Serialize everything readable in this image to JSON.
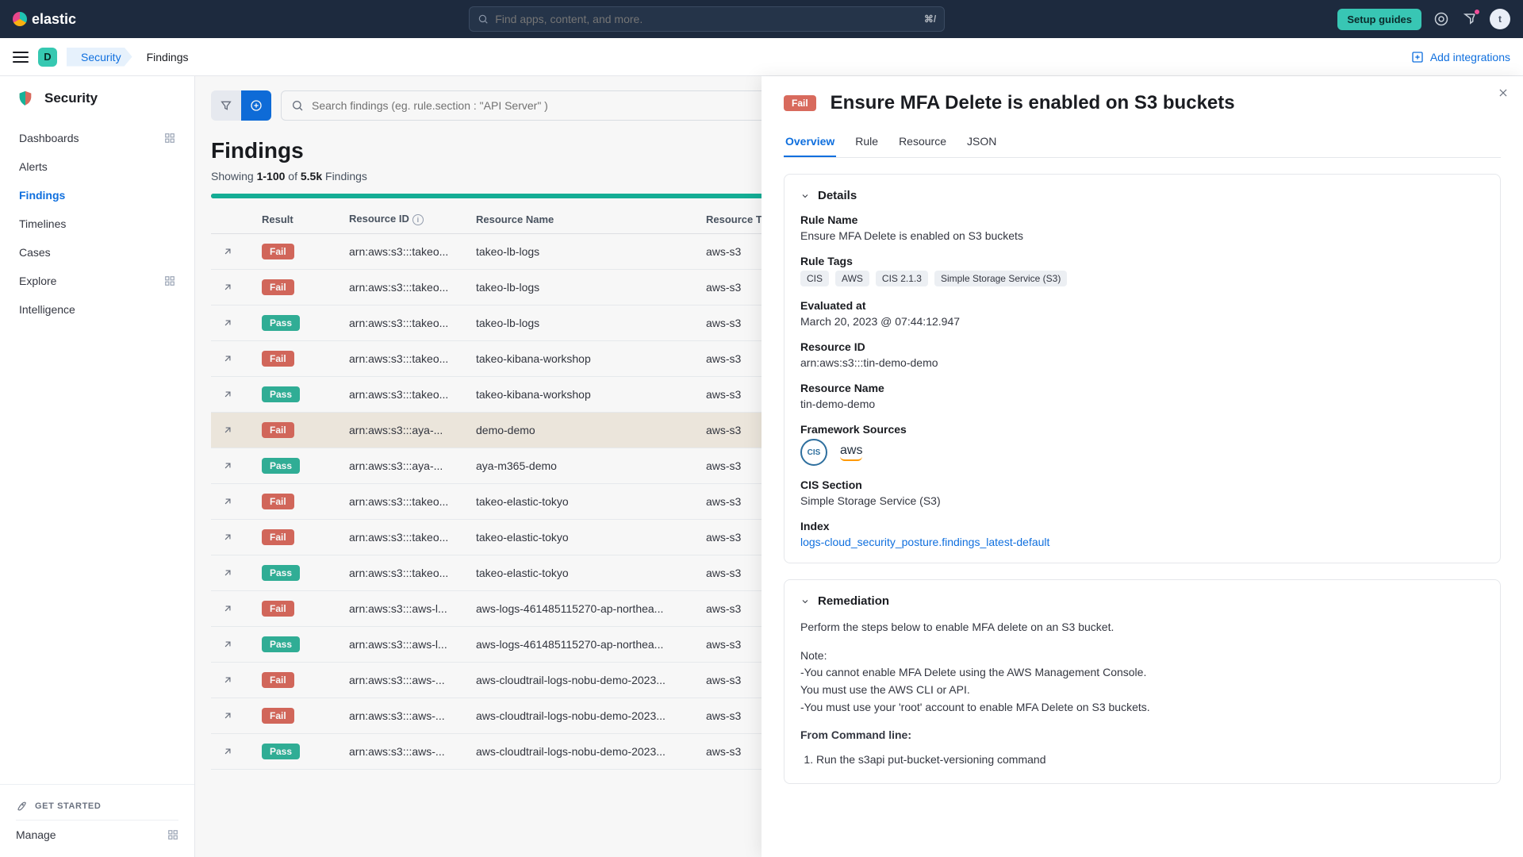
{
  "header": {
    "logo_text": "elastic",
    "search_placeholder": "Find apps, content, and more.",
    "search_shortcut": "⌘/",
    "setup_guides": "Setup guides",
    "avatar_initial": "t"
  },
  "breadcrumb": {
    "space_initial": "D",
    "security": "Security",
    "page": "Findings",
    "add_integrations": "Add integrations"
  },
  "sidebar": {
    "title": "Security",
    "items": [
      {
        "label": "Dashboards",
        "grid": true
      },
      {
        "label": "Alerts"
      },
      {
        "label": "Findings",
        "active": true
      },
      {
        "label": "Timelines"
      },
      {
        "label": "Cases"
      },
      {
        "label": "Explore",
        "grid": true
      },
      {
        "label": "Intelligence"
      }
    ],
    "get_started": "GET STARTED",
    "manage": "Manage"
  },
  "findings": {
    "search_placeholder": "Search findings (eg. rule.section : \"API Server\" )",
    "page_title": "Findings",
    "showing_prefix": "Showing ",
    "showing_range": "1-100",
    "showing_of": " of ",
    "showing_total": "5.5k",
    "showing_suffix": " Findings",
    "columns": {
      "result": "Result",
      "resource_id": "Resource ID",
      "resource_name": "Resource Name",
      "resource_type": "Resource Typ"
    },
    "rows": [
      {
        "result": "Fail",
        "rid": "arn:aws:s3:::takeo...",
        "rname": "takeo-lb-logs",
        "rtype": "aws-s3"
      },
      {
        "result": "Fail",
        "rid": "arn:aws:s3:::takeo...",
        "rname": "takeo-lb-logs",
        "rtype": "aws-s3"
      },
      {
        "result": "Pass",
        "rid": "arn:aws:s3:::takeo...",
        "rname": "takeo-lb-logs",
        "rtype": "aws-s3"
      },
      {
        "result": "Fail",
        "rid": "arn:aws:s3:::takeo...",
        "rname": "takeo-kibana-workshop",
        "rtype": "aws-s3"
      },
      {
        "result": "Pass",
        "rid": "arn:aws:s3:::takeo...",
        "rname": "takeo-kibana-workshop",
        "rtype": "aws-s3"
      },
      {
        "result": "Fail",
        "rid": "arn:aws:s3:::aya-...",
        "rname": "demo-demo",
        "rtype": "aws-s3",
        "selected": true
      },
      {
        "result": "Pass",
        "rid": "arn:aws:s3:::aya-...",
        "rname": "aya-m365-demo",
        "rtype": "aws-s3"
      },
      {
        "result": "Fail",
        "rid": "arn:aws:s3:::takeo...",
        "rname": "takeo-elastic-tokyo",
        "rtype": "aws-s3"
      },
      {
        "result": "Fail",
        "rid": "arn:aws:s3:::takeo...",
        "rname": "takeo-elastic-tokyo",
        "rtype": "aws-s3"
      },
      {
        "result": "Pass",
        "rid": "arn:aws:s3:::takeo...",
        "rname": "takeo-elastic-tokyo",
        "rtype": "aws-s3"
      },
      {
        "result": "Fail",
        "rid": "arn:aws:s3:::aws-l...",
        "rname": "aws-logs-461485115270-ap-northea...",
        "rtype": "aws-s3"
      },
      {
        "result": "Pass",
        "rid": "arn:aws:s3:::aws-l...",
        "rname": "aws-logs-461485115270-ap-northea...",
        "rtype": "aws-s3"
      },
      {
        "result": "Fail",
        "rid": "arn:aws:s3:::aws-...",
        "rname": "aws-cloudtrail-logs-nobu-demo-2023...",
        "rtype": "aws-s3"
      },
      {
        "result": "Fail",
        "rid": "arn:aws:s3:::aws-...",
        "rname": "aws-cloudtrail-logs-nobu-demo-2023...",
        "rtype": "aws-s3"
      },
      {
        "result": "Pass",
        "rid": "arn:aws:s3:::aws-...",
        "rname": "aws-cloudtrail-logs-nobu-demo-2023...",
        "rtype": "aws-s3"
      }
    ]
  },
  "flyout": {
    "badge": "Fail",
    "title": "Ensure MFA Delete is enabled on S3 buckets",
    "tabs": [
      "Overview",
      "Rule",
      "Resource",
      "JSON"
    ],
    "details_heading": "Details",
    "labels": {
      "rule_name": "Rule Name",
      "rule_tags": "Rule Tags",
      "evaluated_at": "Evaluated at",
      "resource_id": "Resource ID",
      "resource_name": "Resource Name",
      "framework_sources": "Framework Sources",
      "cis_section": "CIS Section",
      "index": "Index"
    },
    "rule_name": "Ensure MFA Delete is enabled on S3 buckets",
    "rule_tags": [
      "CIS",
      "AWS",
      "CIS 2.1.3",
      "Simple Storage Service (S3)"
    ],
    "evaluated_at": "March 20, 2023 @ 07:44:12.947",
    "resource_id": "arn:aws:s3:::tin-demo-demo",
    "resource_name": "tin-demo-demo",
    "framework_cis": "CIS",
    "framework_aws": "aws",
    "cis_section": "Simple Storage Service (S3)",
    "index_link": "logs-cloud_security_posture.findings_latest-default",
    "remediation_heading": "Remediation",
    "remediation_intro": "Perform the steps below to enable MFA delete on an S3 bucket.",
    "remediation_note_label": "Note:",
    "remediation_note1": "-You cannot enable MFA Delete using the AWS Management Console.",
    "remediation_note2": "You must use the AWS CLI or API.",
    "remediation_note3": "-You must use your 'root' account to enable MFA Delete on S3 buckets.",
    "remediation_from_cmd": "From Command line:",
    "remediation_step1": "Run the s3api put-bucket-versioning command"
  }
}
